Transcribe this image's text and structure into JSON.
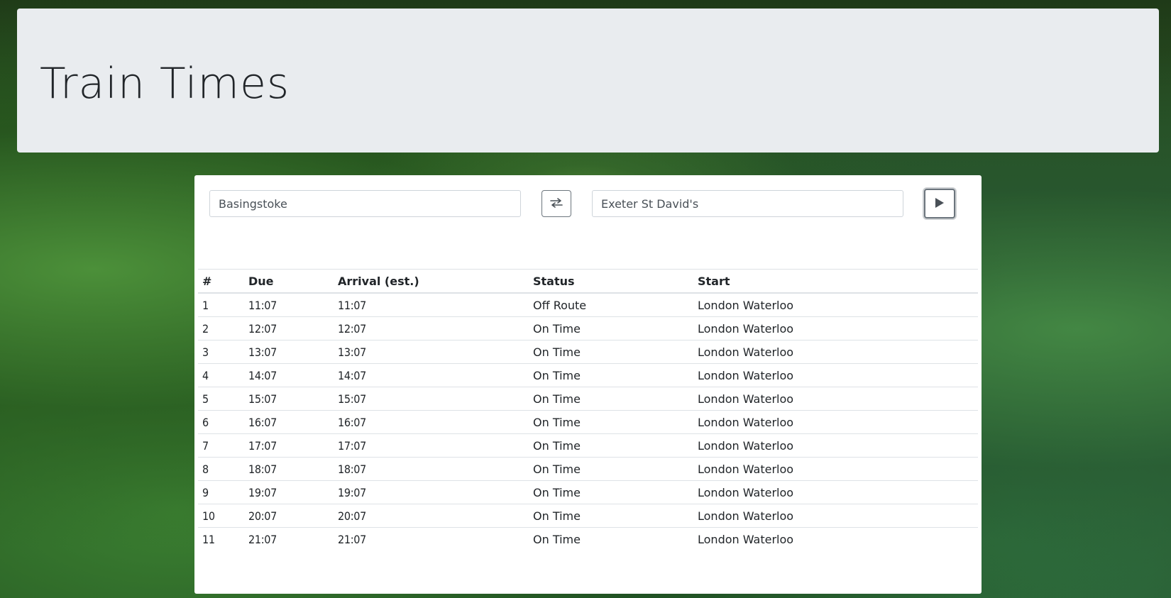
{
  "page": {
    "title": "Train Times"
  },
  "search": {
    "from_value": "Basingstoke",
    "to_value": "Exeter St David's",
    "swap_icon": "swap-arrows-icon",
    "go_icon": "play-icon"
  },
  "table": {
    "headers": [
      "#",
      "Due",
      "Arrival (est.)",
      "Status",
      "Start"
    ],
    "rows": [
      {
        "num": "1",
        "due": "11:07",
        "arrival": "11:07",
        "status": "Off Route",
        "start": "London Waterloo"
      },
      {
        "num": "2",
        "due": "12:07",
        "arrival": "12:07",
        "status": "On Time",
        "start": "London Waterloo"
      },
      {
        "num": "3",
        "due": "13:07",
        "arrival": "13:07",
        "status": "On Time",
        "start": "London Waterloo"
      },
      {
        "num": "4",
        "due": "14:07",
        "arrival": "14:07",
        "status": "On Time",
        "start": "London Waterloo"
      },
      {
        "num": "5",
        "due": "15:07",
        "arrival": "15:07",
        "status": "On Time",
        "start": "London Waterloo"
      },
      {
        "num": "6",
        "due": "16:07",
        "arrival": "16:07",
        "status": "On Time",
        "start": "London Waterloo"
      },
      {
        "num": "7",
        "due": "17:07",
        "arrival": "17:07",
        "status": "On Time",
        "start": "London Waterloo"
      },
      {
        "num": "8",
        "due": "18:07",
        "arrival": "18:07",
        "status": "On Time",
        "start": "London Waterloo"
      },
      {
        "num": "9",
        "due": "19:07",
        "arrival": "19:07",
        "status": "On Time",
        "start": "London Waterloo"
      },
      {
        "num": "10",
        "due": "20:07",
        "arrival": "20:07",
        "status": "On Time",
        "start": "London Waterloo"
      },
      {
        "num": "11",
        "due": "21:07",
        "arrival": "21:07",
        "status": "On Time",
        "start": "London Waterloo"
      }
    ]
  },
  "colors": {
    "jumbotron_bg": "#e9ecef",
    "panel_bg": "#ffffff",
    "border": "#dee2e6",
    "button_border": "#6c757d"
  }
}
